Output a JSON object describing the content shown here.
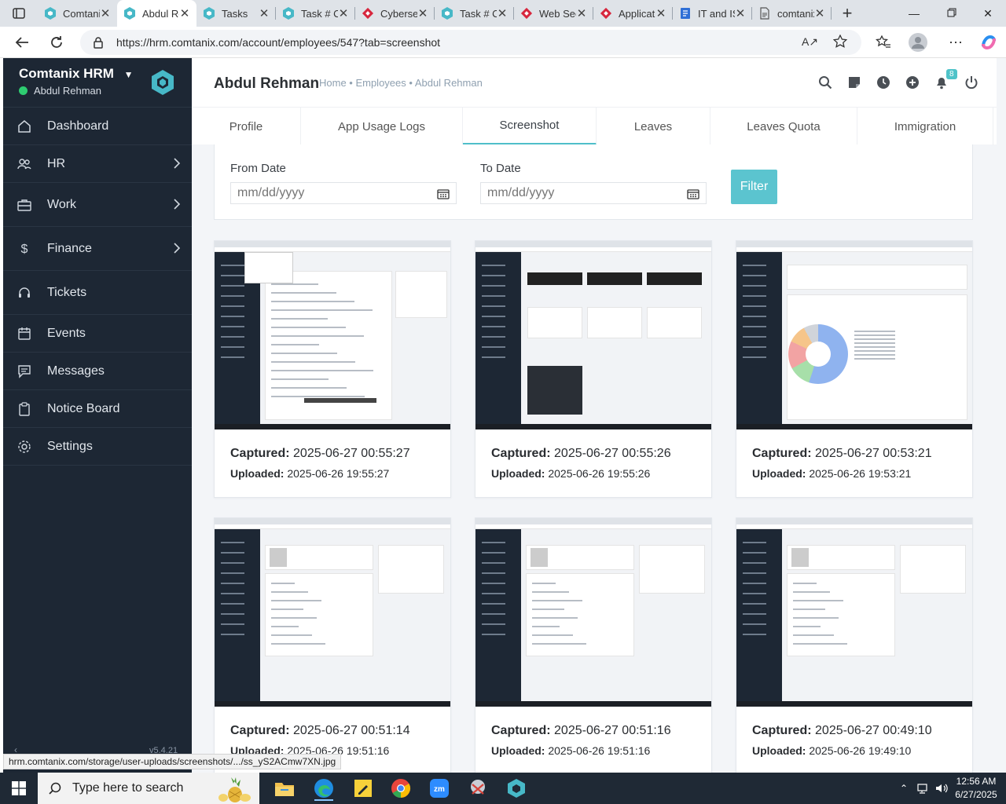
{
  "browser": {
    "tabs": [
      {
        "label": "Comtanix",
        "favicon": "comtanix-logo-icon"
      },
      {
        "label": "Abdul Rehman",
        "favicon": "comtanix-logo-icon",
        "active": true
      },
      {
        "label": "Tasks",
        "favicon": "comtanix-logo-icon"
      },
      {
        "label": "Task # Cyber",
        "favicon": "comtanix-logo-icon"
      },
      {
        "label": "Cybersecurity",
        "favicon": "red-diamond-icon"
      },
      {
        "label": "Task # Cyber",
        "favicon": "comtanix-logo-icon"
      },
      {
        "label": "Web Security",
        "favicon": "red-diamond-icon"
      },
      {
        "label": "Applications",
        "favicon": "red-diamond-icon"
      },
      {
        "label": "IT and IS",
        "favicon": "docs-icon"
      },
      {
        "label": "comtanix",
        "favicon": "page-icon"
      }
    ],
    "url": "https://hrm.comtanix.com/account/employees/547?tab=screenshot",
    "status_url": "hrm.comtanix.com/storage/user-uploads/screenshots/.../ss_yS2ACmw7XN.jpg"
  },
  "sidebar": {
    "company": "Comtanix HRM",
    "user": "Abdul Rehman",
    "items": [
      {
        "label": "Dashboard",
        "icon": "house-icon",
        "has_submenu": false
      },
      {
        "label": "HR",
        "icon": "users-icon",
        "has_submenu": true
      },
      {
        "label": "Work",
        "icon": "briefcase-icon",
        "has_submenu": true
      },
      {
        "label": "Finance",
        "icon": "dollar-icon",
        "has_submenu": true
      },
      {
        "label": "Tickets",
        "icon": "headset-icon",
        "has_submenu": false
      },
      {
        "label": "Events",
        "icon": "calendar-icon",
        "has_submenu": false
      },
      {
        "label": "Messages",
        "icon": "message-icon",
        "has_submenu": false
      },
      {
        "label": "Notice Board",
        "icon": "clipboard-icon",
        "has_submenu": false
      },
      {
        "label": "Settings",
        "icon": "gear-icon",
        "has_submenu": false
      }
    ],
    "version": "v5.4.21"
  },
  "header": {
    "title": "Abdul Rehman",
    "breadcrumb": "Home • Employees • Abdul Rehman",
    "notification_count": "8"
  },
  "tabs": [
    "Profile",
    "App Usage Logs",
    "Screenshot",
    "Leaves",
    "Leaves Quota",
    "Immigration"
  ],
  "active_tab": "Screenshot",
  "filter": {
    "from_label": "From Date",
    "to_label": "To Date",
    "placeholder": "mm/dd/yyyy",
    "button": "Filter"
  },
  "screenshots": [
    {
      "captured_label": "Captured:",
      "captured": "2025-06-27 00:55:27",
      "uploaded_label": "Uploaded:",
      "uploaded": "2025-06-26 19:55:27"
    },
    {
      "captured_label": "Captured:",
      "captured": "2025-06-27 00:55:26",
      "uploaded_label": "Uploaded:",
      "uploaded": "2025-06-26 19:55:26"
    },
    {
      "captured_label": "Captured:",
      "captured": "2025-06-27 00:53:21",
      "uploaded_label": "Uploaded:",
      "uploaded": "2025-06-26 19:53:21"
    },
    {
      "captured_label": "Captured:",
      "captured": "2025-06-27 00:51:14",
      "uploaded_label": "Uploaded:",
      "uploaded": "2025-06-26 19:51:16"
    },
    {
      "captured_label": "Captured:",
      "captured": "2025-06-27 00:51:16",
      "uploaded_label": "Uploaded:",
      "uploaded": "2025-06-26 19:51:16"
    },
    {
      "captured_label": "Captured:",
      "captured": "2025-06-27 00:49:10",
      "uploaded_label": "Uploaded:",
      "uploaded": "2025-06-26 19:49:10"
    }
  ],
  "taskbar": {
    "search_placeholder": "Type here to search",
    "time": "12:56 AM",
    "date": "6/27/2025"
  },
  "colors": {
    "accent": "#5bc4cf",
    "sidebar": "#1d2734",
    "online": "#2ecc71"
  }
}
